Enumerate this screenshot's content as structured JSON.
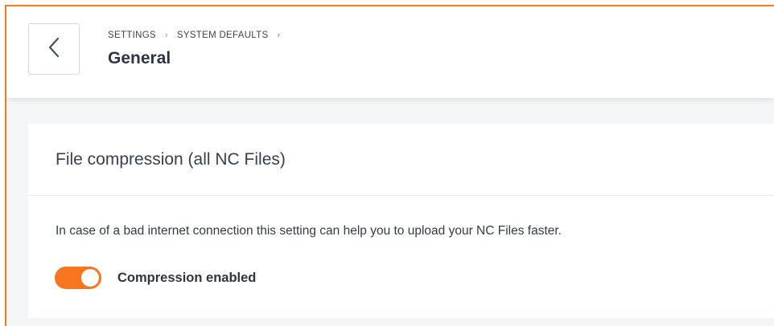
{
  "header": {
    "breadcrumb": [
      "SETTINGS",
      "SYSTEM DEFAULTS"
    ],
    "breadcrumb_separator": "›",
    "title": "General",
    "back_icon": "chevron-left-icon"
  },
  "section": {
    "title": "File compression (all NC Files)",
    "description": "In case of a bad internet connection this setting can help you to upload your NC Files faster.",
    "toggle": {
      "label": "Compression enabled",
      "checked": true
    }
  },
  "colors": {
    "accent": "#f7761f",
    "frame_border": "#f07c1b",
    "background": "#f4f5f7"
  }
}
